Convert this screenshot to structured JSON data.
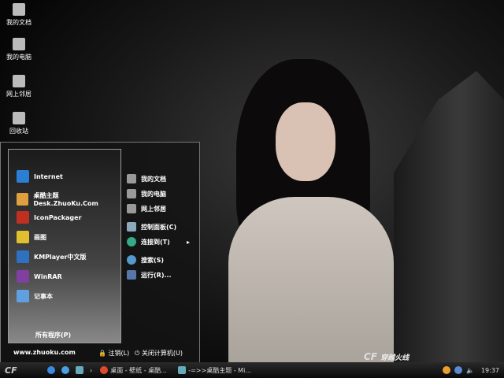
{
  "desktop_icons": [
    {
      "label": "我的文档",
      "icon": "my-documents-icon"
    },
    {
      "label": "我的电脑",
      "icon": "my-computer-icon"
    },
    {
      "label": "网上邻居",
      "icon": "network-icon"
    },
    {
      "label": "回收站",
      "icon": "recycle-bin-icon"
    }
  ],
  "start_menu": {
    "programs": [
      {
        "label": "Internet",
        "color": "#2a7fd4"
      },
      {
        "label": "桌酷主题Desk.ZhuoKu.Com",
        "color": "#e0a040"
      },
      {
        "label": "IconPackager",
        "color": "#c03020"
      },
      {
        "label": "画图",
        "color": "#e0c030"
      },
      {
        "label": "KMPlayer中文版",
        "color": "#3070c0"
      },
      {
        "label": "WinRAR",
        "color": "#8040a0"
      },
      {
        "label": "记事本",
        "color": "#60a0e0"
      }
    ],
    "all_programs": "所有程序(P)",
    "right_items": [
      "我的文档",
      "我的电脑",
      "网上邻居",
      "控制面板(C)",
      "连接到(T)",
      "搜索(S)",
      "运行(R)..."
    ],
    "website": "www.zhuoku.com",
    "logoff": "注销(L)",
    "shutdown": "关闭计算机(U)"
  },
  "taskbar": {
    "tasks": [
      "桌面 - 壁纸 - 桌酷...",
      "-=>>桌酷主题 - Mi..."
    ],
    "clock": "19:37",
    "brand": "CF 穿越火线"
  }
}
